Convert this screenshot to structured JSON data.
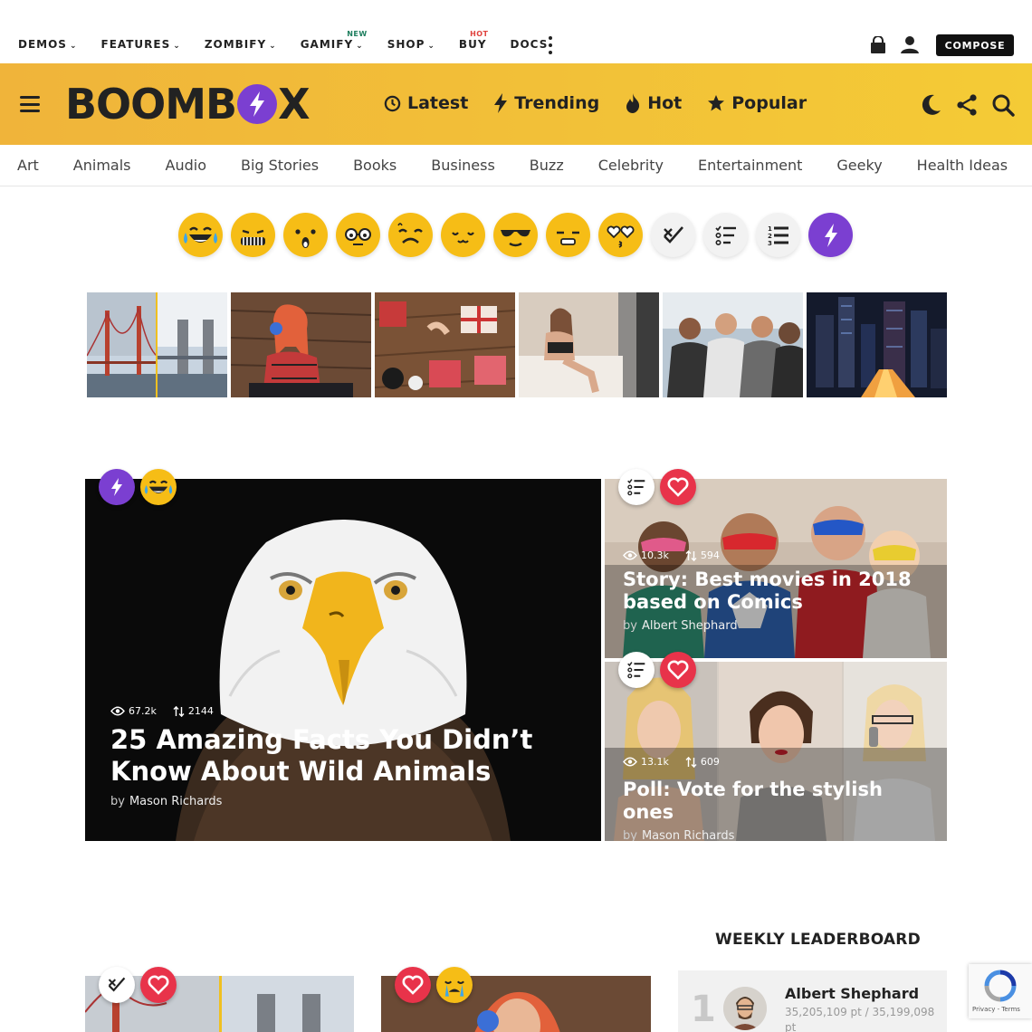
{
  "topnav": {
    "items": [
      {
        "label": "DEMOS",
        "chevron": true
      },
      {
        "label": "FEATURES",
        "chevron": true
      },
      {
        "label": "ZOMBIFY",
        "chevron": true
      },
      {
        "label": "GAMIFY",
        "chevron": true,
        "badge": "NEW"
      },
      {
        "label": "SHOP",
        "chevron": true
      },
      {
        "label": "BUY",
        "chevron": false,
        "badge": "HOT"
      },
      {
        "label": "DOCS",
        "chevron": false
      }
    ],
    "compose_label": "COMPOSE"
  },
  "header": {
    "logo": {
      "left": "BOOMB",
      "right": "X"
    },
    "nav": [
      {
        "label": "Latest",
        "icon": "clock-icon"
      },
      {
        "label": "Trending",
        "icon": "bolt-icon"
      },
      {
        "label": "Hot",
        "icon": "flame-icon"
      },
      {
        "label": "Popular",
        "icon": "star-icon"
      }
    ],
    "accent_from": "#f0b43a",
    "accent_to": "#f4cb36"
  },
  "categories": [
    "Art",
    "Animals",
    "Audio",
    "Big Stories",
    "Books",
    "Business",
    "Buzz",
    "Celebrity",
    "Entertainment",
    "Geeky",
    "Health Ideas"
  ],
  "reactions": [
    "lol",
    "omg",
    "wow",
    "geeky",
    "cry",
    "cute",
    "cool",
    "meh",
    "love",
    "versus",
    "list",
    "numbered-list",
    "trending"
  ],
  "thumbnails": [
    "bridges",
    "dj-girl",
    "gift-boxes",
    "woman-on-bed",
    "friends-party",
    "city-night"
  ],
  "featured": {
    "main": {
      "views": "67.2k",
      "shares": "2144",
      "title": "25 Amazing Facts You Didn’t Know About Wild Animals",
      "by": "by",
      "author": "Mason Richards"
    },
    "side1": {
      "views": "10.3k",
      "shares": "594",
      "title": "Story: Best movies in 2018 based on Comics",
      "by": "by",
      "author": "Albert Shephard"
    },
    "side2": {
      "views": "13.1k",
      "shares": "609",
      "title": "Poll: Vote for the stylish ones",
      "by": "by",
      "author": "Mason Richards"
    }
  },
  "leaderboard": {
    "title": "WEEKLY LEADERBOARD",
    "rank": "1",
    "name": "Albert Shephard",
    "points": "35,205,109 pt / 35,199,098 pt"
  },
  "recaptcha": {
    "terms": "Privacy - Terms"
  },
  "colors": {
    "purple": "#7b3fd1",
    "emoji_yellow": "#f6bd16",
    "heart_red": "#e8334a"
  }
}
